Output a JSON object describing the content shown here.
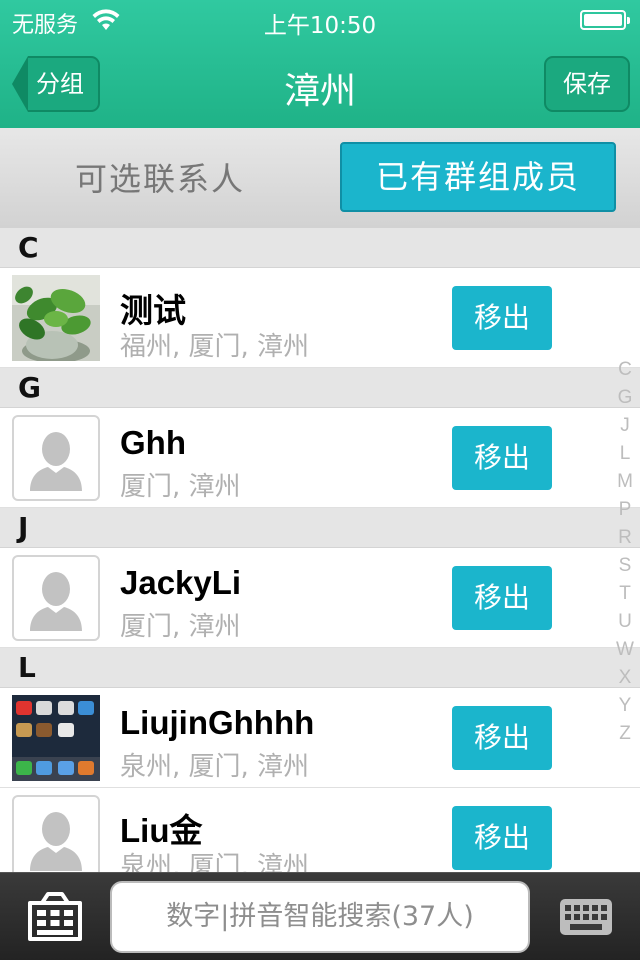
{
  "status_bar": {
    "carrier": "无服务",
    "time": "上午10:50"
  },
  "nav": {
    "back_label": "分组",
    "title": "漳州",
    "save_label": "保存"
  },
  "segments": {
    "left": "可选联系人",
    "right": "已有群组成员"
  },
  "sections": [
    {
      "letter": "C",
      "contacts": [
        {
          "name": "测试",
          "groups": "福州, 厦门, 漳州",
          "avatar": "plant-photo",
          "action": "移出"
        }
      ]
    },
    {
      "letter": "G",
      "contacts": [
        {
          "name": "Ghh",
          "groups": "厦门, 漳州",
          "avatar": "default-person-icon",
          "action": "移出"
        }
      ]
    },
    {
      "letter": "J",
      "contacts": [
        {
          "name": "JackyLi",
          "groups": "厦门, 漳州",
          "avatar": "default-person-icon",
          "action": "移出"
        }
      ]
    },
    {
      "letter": "L",
      "contacts": [
        {
          "name": "LiujinGhhhh",
          "groups": "泉州, 厦门, 漳州",
          "avatar": "homescreen-photo",
          "action": "移出"
        },
        {
          "name": "Liu金",
          "groups": "泉州, 厦门, 漳州",
          "avatar": "default-person-icon",
          "action": "移出"
        }
      ]
    }
  ],
  "index_letters": [
    "C",
    "G",
    "J",
    "L",
    "M",
    "P",
    "R",
    "S",
    "T",
    "U",
    "W",
    "X",
    "Y",
    "Z"
  ],
  "bottom": {
    "search_placeholder": "数字|拼音智能搜索(37人)"
  },
  "colors": {
    "nav_teal": "#21b68a",
    "accent_cyan": "#1bb5cc",
    "section_gray": "#e5e5e5"
  }
}
